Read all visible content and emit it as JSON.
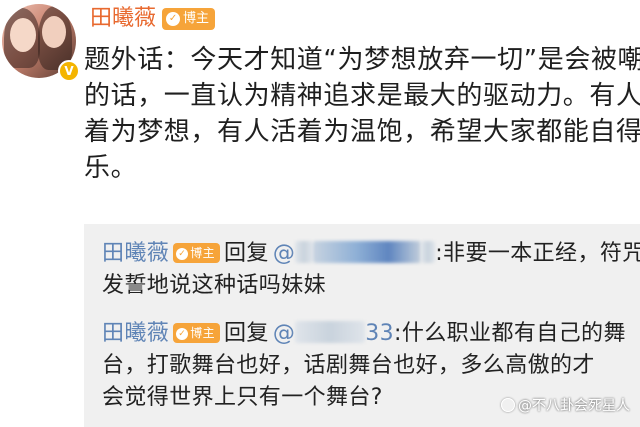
{
  "post": {
    "author": "田曦薇",
    "author_tag": "博主",
    "verified_badge": "V",
    "lines": [
      "题外话：今天才知道“为梦想放弃一切”是会被嘲笑",
      "的话，一直认为精神追求是最大的驱动力。有人活",
      "着为梦想，有人活着为温饱，希望大家都能自得其",
      "乐。"
    ]
  },
  "comments": [
    {
      "author": "田曦薇",
      "tag": "博主",
      "reply_word": "回复",
      "mention_prefix": "@",
      "mention_tail": "",
      "line1_text": ":非要一本正经，符咒",
      "line2_text": "发誓地说这种话吗妹妹"
    },
    {
      "author": "田曦薇",
      "tag": "博主",
      "reply_word": "回复",
      "mention_prefix": "@",
      "mention_tail": "33",
      "line1_text": ":什么职业都有自己的舞",
      "line2_text": "台，打歌舞台也好，话剧舞台也好，多么高傲的才",
      "line3_text": "会觉得世界上只有一个舞台?"
    }
  ],
  "watermark": "@不八卦会死星人",
  "colors": {
    "username": "#e8692f",
    "tag_bg": "#f6a43a",
    "link_blue": "#5f84b6",
    "comment_bg": "#f0f0f0"
  }
}
